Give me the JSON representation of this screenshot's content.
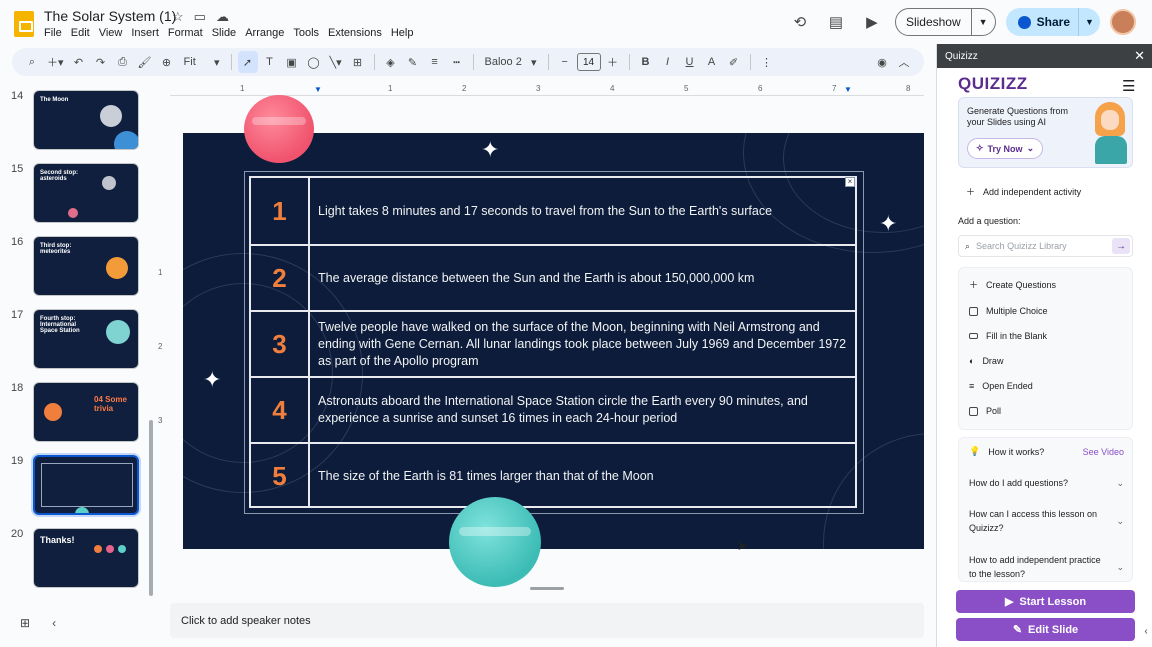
{
  "header": {
    "title": "The Solar System (1)",
    "menu": [
      "File",
      "Edit",
      "View",
      "Insert",
      "Format",
      "Slide",
      "Arrange",
      "Tools",
      "Extensions",
      "Help"
    ],
    "slideshow_label": "Slideshow",
    "share_label": "Share"
  },
  "toolbar": {
    "zoom_label": "Fit",
    "font_label": "Baloo 2",
    "font_size": "14"
  },
  "filmstrip": {
    "slides": [
      {
        "num": "14",
        "title": "The Moon"
      },
      {
        "num": "15",
        "title": "Second stop: asteroids"
      },
      {
        "num": "16",
        "title": "Third stop: meteorites"
      },
      {
        "num": "17",
        "title": "Fourth stop: International Space Station"
      },
      {
        "num": "18",
        "title": "04 Some trivia"
      },
      {
        "num": "19",
        "title": ""
      },
      {
        "num": "20",
        "title": "Thanks!"
      }
    ]
  },
  "ruler": {
    "h": [
      "1",
      "1",
      "2",
      "3",
      "4",
      "5",
      "6",
      "7",
      "8"
    ],
    "v": [
      "1",
      "2",
      "3"
    ]
  },
  "slide": {
    "facts": [
      {
        "num": "1",
        "text": "Light takes 8 minutes and 17 seconds to travel from the Sun to the Earth's surface"
      },
      {
        "num": "2",
        "text": "The average distance between the Sun and the Earth is about 150,000,000 km"
      },
      {
        "num": "3",
        "text": "Twelve people have walked on the surface of the Moon, beginning with Neil Armstrong and ending with Gene Cernan. All lunar landings took place between July 1969 and December 1972 as part of the Apollo program"
      },
      {
        "num": "4",
        "text": "Astronauts aboard the International Space Station circle the Earth every 90 minutes, and experience a sunrise and sunset 16 times in each 24-hour period"
      },
      {
        "num": "5",
        "text": "The size of the Earth is 81 times larger than that of the Moon"
      }
    ]
  },
  "notes": {
    "placeholder": "Click to add speaker notes"
  },
  "quizizz": {
    "panel_title": "Quizizz",
    "logo": "QUIZIZZ",
    "promo_text": "Generate Questions from your Slides using AI",
    "try_now": "Try Now",
    "add_independent": "Add independent activity",
    "add_question_label": "Add a question:",
    "search_placeholder": "Search Quizizz Library",
    "create_questions": "Create Questions",
    "question_types": [
      "Multiple Choice",
      "Fill in the Blank",
      "Draw",
      "Open Ended",
      "Poll"
    ],
    "how_it_works": "How it works?",
    "see_video": "See Video",
    "faqs": [
      "How do I add questions?",
      "How can I access this lesson on Quizizz?",
      "How to add independent practice to the lesson?"
    ],
    "start_lesson": "Start Lesson",
    "edit_slide": "Edit Slide"
  },
  "colors": {
    "slide_bg": "#0d1c3a",
    "number_accent": "#f07f3e",
    "quizizz_purple": "#8a4fc7"
  }
}
